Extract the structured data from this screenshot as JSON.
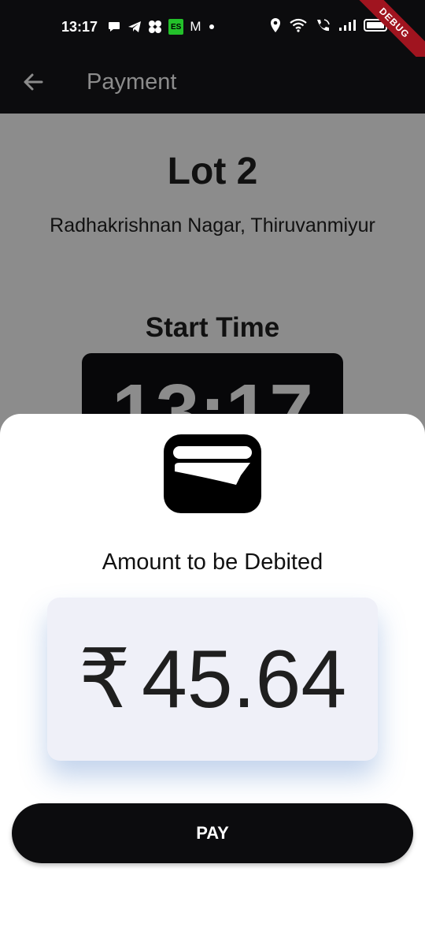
{
  "status_bar": {
    "time": "13:17",
    "left_icons": [
      "chat-icon",
      "telegram-icon",
      "pinwheel-icon",
      "es-badge-icon",
      "gmail-icon",
      "dot-icon"
    ],
    "es_label": "ES",
    "gmail_label": "M",
    "right_icons": [
      "location-icon",
      "wifi-icon",
      "wifi-call-icon",
      "signal-icon",
      "battery-icon"
    ]
  },
  "debug_banner": "DEBUG",
  "app_bar": {
    "title": "Payment",
    "back_icon": "arrow-left-icon"
  },
  "page": {
    "lot_title": "Lot 2",
    "address": "Radhakrishnan Nagar, Thiruvanmiyur",
    "start_time_label": "Start Time",
    "start_time_value": "13:17"
  },
  "payment_sheet": {
    "icon": "wallet-icon",
    "amount_label": "Amount to be Debited",
    "currency_symbol": "₹",
    "amount": "45.64",
    "pay_label": "PAY"
  },
  "colors": {
    "app_bar": "#0c0c0e",
    "sheet": "#ffffff",
    "amount_card": "#eff0f8",
    "pay_button": "#0c0c0e",
    "debug_ribbon": "#a0141f"
  }
}
